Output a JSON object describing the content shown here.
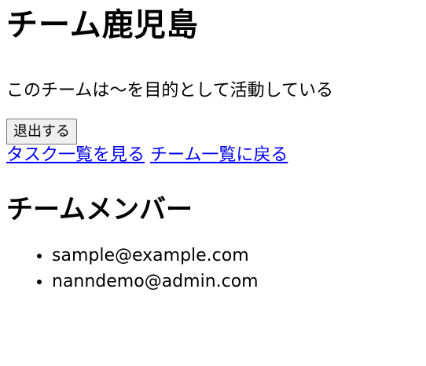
{
  "team": {
    "name": "チーム鹿児島",
    "description": "このチームは〜を目的として活動している"
  },
  "actions": {
    "leave_label": "退出する",
    "view_tasks_label": "タスク一覧を見る",
    "back_to_teams_label": "チーム一覧に戻る"
  },
  "members": {
    "heading": "チームメンバー",
    "list": [
      "sample@example.com",
      "nanndemo@admin.com"
    ]
  }
}
